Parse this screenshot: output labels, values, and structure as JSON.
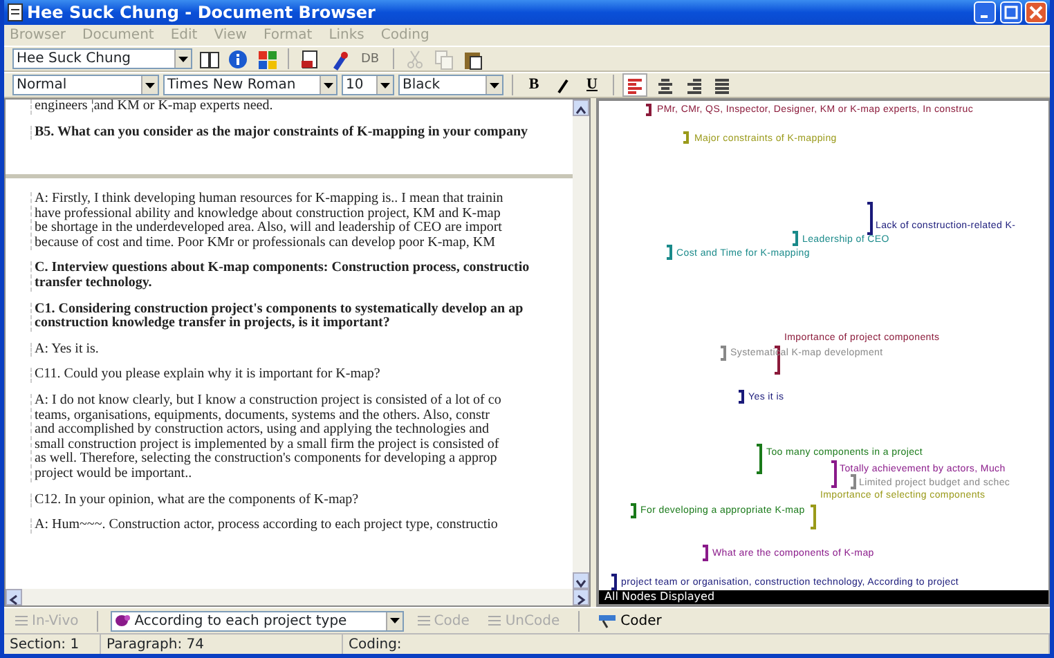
{
  "window": {
    "title": "Hee Suck Chung - Document Browser"
  },
  "menu": [
    {
      "label": "Browser",
      "disabled": true
    },
    {
      "label": "Document",
      "disabled": true
    },
    {
      "label": "Edit",
      "disabled": true
    },
    {
      "label": "View",
      "disabled": true
    },
    {
      "label": "Format",
      "disabled": true
    },
    {
      "label": "Links",
      "disabled": true
    },
    {
      "label": "Coding",
      "disabled": true
    }
  ],
  "toolbar": {
    "document_combo": "Hee Suck Chung",
    "tools": [
      {
        "kind": "book",
        "disabled": false
      },
      {
        "kind": "info",
        "disabled": false
      },
      {
        "kind": "grid",
        "disabled": false
      },
      {
        "kind": "sep"
      },
      {
        "kind": "doc",
        "disabled": false
      },
      {
        "kind": "brush",
        "disabled": false
      },
      {
        "kind": "db",
        "label": "DB",
        "disabled": true
      },
      {
        "kind": "sep"
      },
      {
        "kind": "cut",
        "disabled": true
      },
      {
        "kind": "copy",
        "disabled": true
      },
      {
        "kind": "paste",
        "disabled": false
      }
    ]
  },
  "format_bar": {
    "style": "Normal",
    "font": "Times New Roman",
    "size": "10",
    "ink_label": "Black",
    "styles": [
      {
        "kind": "bold",
        "label": "B"
      },
      {
        "kind": "italic"
      },
      {
        "kind": "underline",
        "label": "U"
      }
    ],
    "align": [
      {
        "kind": "left",
        "selected": true
      },
      {
        "kind": "center",
        "selected": false
      },
      {
        "kind": "right",
        "selected": false
      },
      {
        "kind": "justify",
        "selected": false
      }
    ]
  },
  "upper_pane": [
    {
      "kind": "normal",
      "lines": [
        "engineers ¦and KM or K-map experts need."
      ]
    },
    {
      "kind": "heading",
      "lines": [
        "B5. What can you consider as the major constraints of K-mapping in your company"
      ]
    }
  ],
  "lower_pane": [
    {
      "kind": "normal",
      "lines": [
        "A: Firstly, I think developing human resources for K-mapping is.. I mean that trainin",
        "have professional ability and knowledge about construction project, KM and K-map",
        "be shortage in the underdeveloped area. Also, will and leadership of CEO are import",
        "because of cost and time. Poor KMr or professionals can develop poor K-map, KM"
      ]
    },
    {
      "kind": "heading",
      "lines": [
        "C. Interview questions about K-map components: Construction process, constructio",
        "transfer technology."
      ]
    },
    {
      "kind": "heading",
      "lines": [
        "C1. Considering construction project's components to systematically develop an ap",
        "construction knowledge transfer in projects, is it important?"
      ]
    },
    {
      "kind": "normal",
      "lines": [
        "A: Yes it is."
      ]
    },
    {
      "kind": "normal",
      "lines": [
        "C11. Could you please explain why it is important for K-map?"
      ]
    },
    {
      "kind": "normal",
      "lines": [
        "A: I do not know clearly, but I know a construction project is consisted of a lot of co",
        "teams, organisations, equipments, documents, systems and the others. Also, constr",
        "and accomplished by construction actors, using and applying the technologies and",
        "small construction project is implemented by a small firm the project is consisted of",
        "as well. Therefore, selecting the construction's components for developing a approp",
        "project would be important.."
      ]
    },
    {
      "kind": "normal",
      "lines": [
        "C12. In your opinion, what are the components of K-map?"
      ]
    },
    {
      "kind": "normal",
      "lines": [
        "A: Hum~~~. Construction actor, process according to each project type, constructio"
      ]
    }
  ],
  "coding_stripes": [
    {
      "label": "PMr, CMr, QS, Inspector, Designer, KM or K-map experts, In construc",
      "color": "#8b1a3a"
    },
    {
      "label": "Major constraints of K-mapping",
      "color": "#9a9a1a"
    },
    {
      "label": "Lack of construction-related K-",
      "color": "#1a1a7a"
    },
    {
      "label": "Leadership of CEO",
      "color": "#1a8a8a"
    },
    {
      "label": "Cost and Time for K-mapping",
      "color": "#1a8a8a"
    },
    {
      "label": "Importance of project components",
      "color": "#8b1a3a"
    },
    {
      "label": "Systematical K-map development",
      "color": "#888888"
    },
    {
      "label": "Yes it is",
      "color": "#1a1a7a"
    },
    {
      "label": "Too many components in a project",
      "color": "#1a7a1a"
    },
    {
      "label": "Totally achievement by actors, Much",
      "color": "#8a1a8a"
    },
    {
      "label": "Limited project budget and schec",
      "color": "#888888"
    },
    {
      "label": "Importance of selecting components",
      "color": "#9a9a1a"
    },
    {
      "label": "For developing a appropriate K-map",
      "color": "#1a7a1a"
    },
    {
      "label": "What are the components of K-map",
      "color": "#8a1a8a"
    },
    {
      "label": "project team or organisation, construction technology, According to project",
      "color": "#1a1a7a"
    }
  ],
  "stripes_footer": "All Nodes Displayed",
  "coding_bar": {
    "in_vivo": {
      "label": "In-Vivo",
      "disabled": true
    },
    "node_combo": "According to each project type",
    "code": {
      "label": "Code",
      "disabled": true
    },
    "uncode": {
      "label": "UnCode",
      "disabled": true
    },
    "coder": {
      "label": "Coder",
      "disabled": false
    }
  },
  "status_bar": {
    "section": "Section: 1",
    "paragraph": "Paragraph: 74",
    "coding": "Coding:"
  }
}
